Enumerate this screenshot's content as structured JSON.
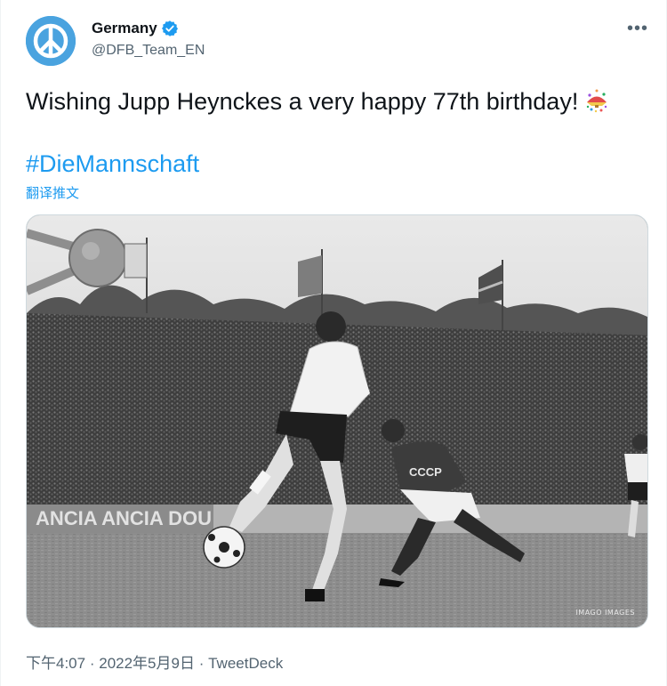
{
  "author": {
    "name": "Germany",
    "handle": "@DFB_Team_EN",
    "verified_icon": "verified-badge-icon",
    "avatar_icon": "peace-sign-icon"
  },
  "tweet": {
    "text": "Wishing Jupp Heynckes a very happy 77th birthday!",
    "emoji": "confetti-ball-icon",
    "hashtag": "#DieMannschaft",
    "translate_label": "翻译推文"
  },
  "media": {
    "alt": "Black and white photo of a footballer kicking the ball in a crowded stadium",
    "shirt_text": "CCCP",
    "banner_text": "ANCIA  ANCIA  DOU",
    "watermark": "IMAGO IMAGES"
  },
  "meta": {
    "time": "下午4:07",
    "date": "2022年5月9日",
    "separator": "·",
    "client": "TweetDeck"
  },
  "colors": {
    "accent": "#1d9bf0",
    "text": "#0f1419",
    "secondary": "#536471"
  }
}
